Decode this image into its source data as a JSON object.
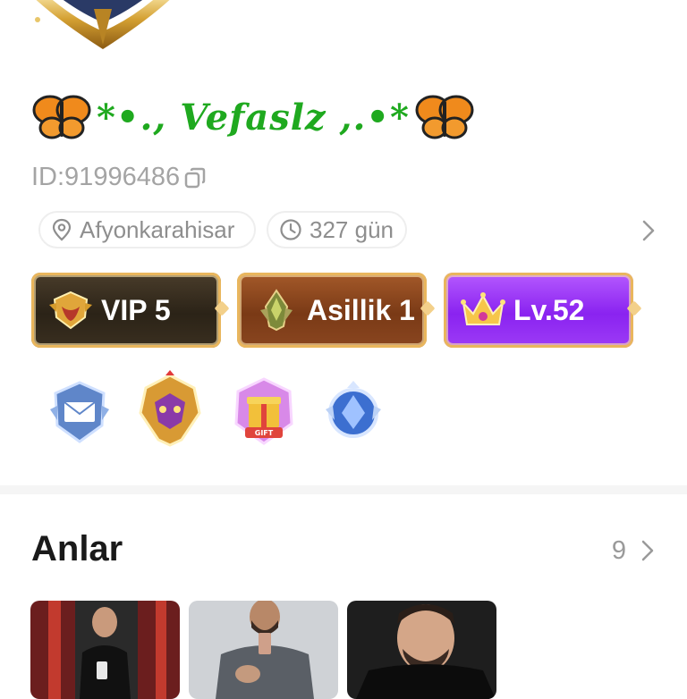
{
  "profile": {
    "nickname": "*•., Vefaslz ,.•*",
    "id_label": "ID:91996486",
    "location": "Afyonkarahisar",
    "days": "327 gün"
  },
  "badges": [
    {
      "label": "VIP 5",
      "icon": "vip-crest-icon"
    },
    {
      "label": "Asillik 1",
      "icon": "nobility-crest-icon"
    },
    {
      "label": "Lv.52",
      "icon": "crown-icon"
    }
  ],
  "medals": [
    "envelope-shield-medal",
    "golden-wolf-medal",
    "gift-box-medal",
    "blue-crest-medal"
  ],
  "moments": {
    "title": "Anlar",
    "count": "9"
  },
  "colors": {
    "nickname": "#1fa91f",
    "vip_bg": "#2b2317",
    "nobility_bg": "#7a3a16",
    "level_bg": "#8a23f0",
    "gold_border": "#e9b65d"
  }
}
